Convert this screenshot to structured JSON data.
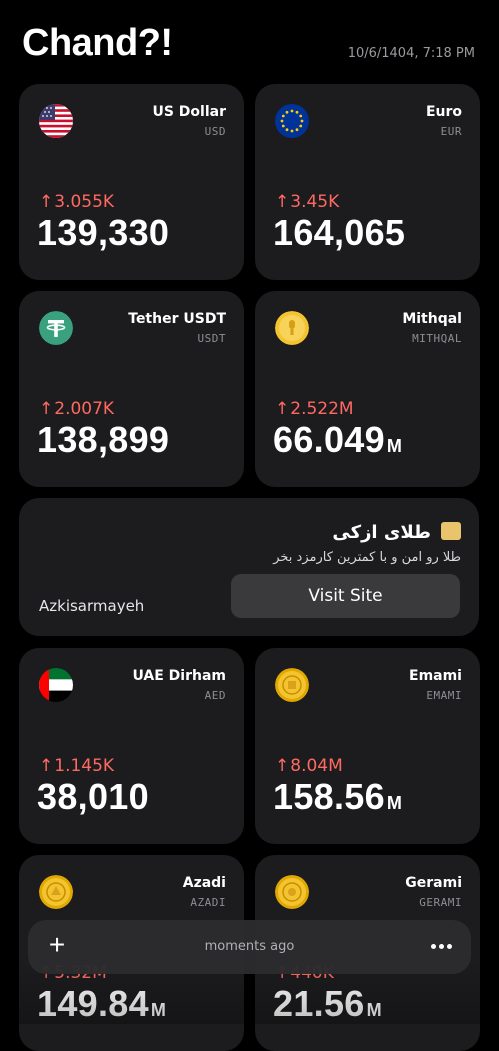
{
  "header": {
    "title": "Chand?!",
    "timestamp": "10/6/1404, 7:18 PM"
  },
  "cards": [
    {
      "name": "US Dollar",
      "code": "USD",
      "change": "3.055K",
      "price": "139,330",
      "unit": "",
      "icon": "us-flag-icon"
    },
    {
      "name": "Euro",
      "code": "EUR",
      "change": "3.45K",
      "price": "164,065",
      "unit": "",
      "icon": "eu-flag-icon"
    },
    {
      "name": "Tether USDT",
      "code": "USDT",
      "change": "2.007K",
      "price": "138,899",
      "unit": "",
      "icon": "tether-icon"
    },
    {
      "name": "Mithqal",
      "code": "MITHQAL",
      "change": "2.522M",
      "price": "66.049",
      "unit": "M",
      "icon": "gold-mithqal-icon"
    },
    {
      "name": "UAE Dirham",
      "code": "AED",
      "change": "1.145K",
      "price": "38,010",
      "unit": "",
      "icon": "uae-flag-icon"
    },
    {
      "name": "Emami",
      "code": "EMAMI",
      "change": "8.04M",
      "price": "158.56",
      "unit": "M",
      "icon": "gold-coin-icon"
    },
    {
      "name": "Azadi",
      "code": "AZADI",
      "change": "5.32M",
      "price": "149.84",
      "unit": "M",
      "icon": "gold-coin-icon"
    },
    {
      "name": "Gerami",
      "code": "GERAMI",
      "change": "440K",
      "price": "21.56",
      "unit": "M",
      "icon": "gold-coin-icon"
    }
  ],
  "ad": {
    "title": "طلای ازکی",
    "subtitle": "طلا رو امن و با کمترین کارمزد بخر",
    "brand": "Azkisarmayeh",
    "button": "Visit Site"
  },
  "bottom_bar": {
    "add_label": "+",
    "status": "moments ago"
  },
  "colors": {
    "background": "#000000",
    "card": "#1c1c1e",
    "change_up": "#ff6961"
  }
}
